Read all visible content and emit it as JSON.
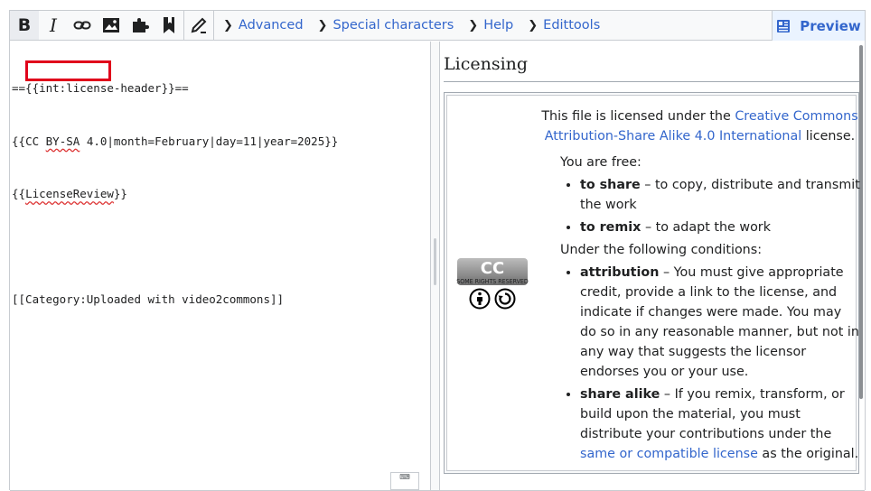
{
  "toolbar": {
    "buttons": [
      {
        "name": "bold-icon",
        "label": "B"
      },
      {
        "name": "italic-icon",
        "label": "I"
      },
      {
        "name": "link-icon"
      },
      {
        "name": "image-icon"
      },
      {
        "name": "puzzle-icon"
      },
      {
        "name": "bookmark-icon"
      },
      {
        "name": "pencil-icon"
      }
    ],
    "tabs": [
      {
        "label": "Advanced"
      },
      {
        "label": "Special characters"
      },
      {
        "label": "Help"
      },
      {
        "label": "Edittools"
      }
    ],
    "preview_label": "Preview"
  },
  "source": {
    "line1": "=={{int:license-header}}==",
    "line2_prefix": "{{",
    "line2_cc": "CC",
    "line2_mid": " ",
    "line2_bysa": "BY-SA",
    "line2_rest": " 4.0|month=February|day=11|year=2025}}",
    "line3_prefix": "{{",
    "line3_word": "LicenseReview",
    "line3_suffix": "}}",
    "line4": "",
    "line5": "[[Category:Uploaded with video2commons]]"
  },
  "preview": {
    "heading": "Licensing",
    "cc_badge": "CC",
    "cc_sub": "SOME RIGHTS RESERVED",
    "intro_before": "This file is licensed under the ",
    "intro_link": "Creative Commons Attribution-Share Alike 4.0 International",
    "intro_after": " license.",
    "free_heading": "You are free:",
    "share_term": "to share",
    "share_desc": " – to copy, distribute and transmit the work",
    "remix_term": "to remix",
    "remix_desc": " – to adapt the work",
    "conditions_heading": "Under the following conditions:",
    "attribution_term": "attribution",
    "attribution_desc": " – You must give appropriate credit, provide a link to the license, and indicate if changes were made. You may do so in any reasonable manner, but not in any way that suggests the licensor endorses you or your use.",
    "sharealike_term": "share alike",
    "sharealike_desc": " – If you remix, transform, or build upon the material, you must distribute your contributions under the ",
    "sharealike_link": "same or compatible license",
    "sharealike_after": " as the original."
  },
  "colors": {
    "link": "#3366cc",
    "highlight": "#e0001b",
    "preview_bg": "#eaf3ff"
  }
}
